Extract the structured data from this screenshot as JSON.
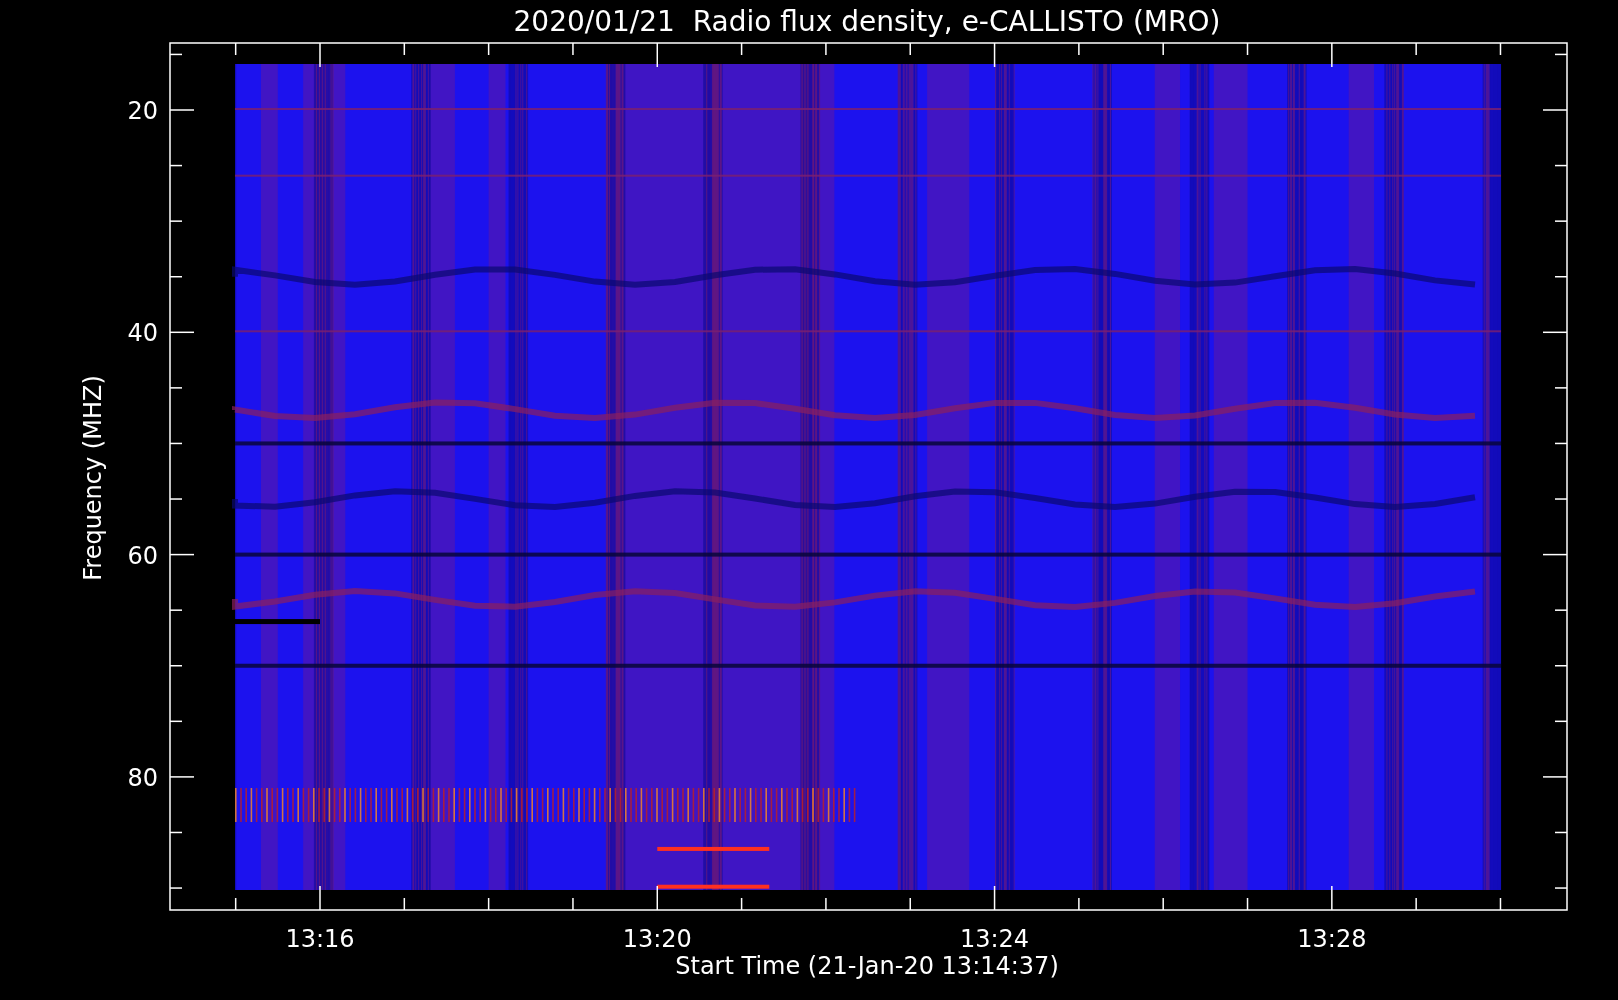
{
  "title": "2020/01/21  Radio flux density, e-CALLISTO (MRO)",
  "y_axis": {
    "label": "Frequency (MHZ)",
    "ticks": [
      "20",
      "40",
      "60",
      "80"
    ]
  },
  "x_axis": {
    "label": "Start Time (21-Jan-20 13:14:37)",
    "ticks": [
      "13:16",
      "13:20",
      "13:24",
      "13:28"
    ]
  }
}
